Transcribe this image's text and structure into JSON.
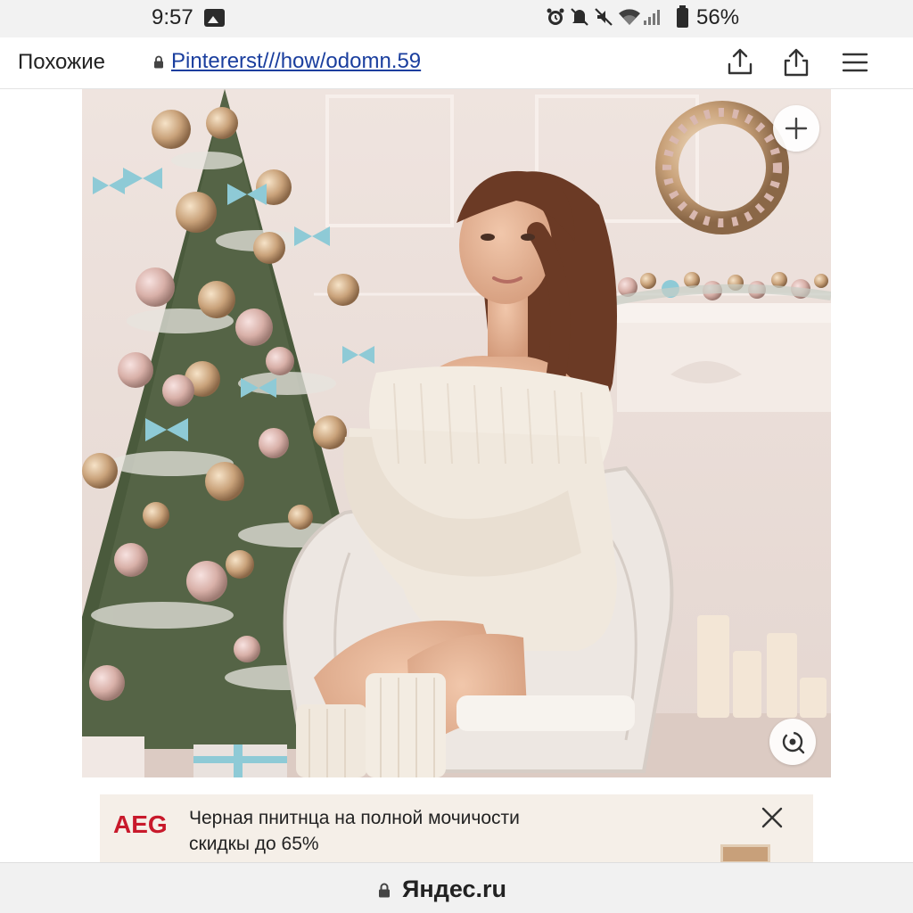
{
  "status_bar": {
    "time": "9:57",
    "battery_percent": "56%",
    "icons": [
      "photo-icon",
      "alarm-icon",
      "mute-icon",
      "vibrate-off-icon",
      "wifi-icon",
      "signal-icon",
      "battery-icon"
    ]
  },
  "address_bar": {
    "similar_label": "Похожие",
    "url": "Pintererst///how/odomn.59",
    "icons": [
      "lock-icon",
      "share-icon",
      "upload-icon",
      "menu-icon"
    ]
  },
  "image": {
    "buttons": [
      "plus-icon",
      "visual-search-icon"
    ],
    "colors": {
      "wall": "#e9ddd8",
      "sweater": "#f3ece2",
      "tree_green": "#4a5a3c",
      "ornament_gold": "#c9a27a",
      "ribbon_blue": "#8ecad6"
    }
  },
  "ad": {
    "brand": "AEG",
    "line1": "Черная пнитнца на полной мочичости",
    "line2": "скидкы до 65%",
    "brand_color": "#c8192b"
  },
  "bottom_bar": {
    "domain": "Яндес.ru"
  }
}
